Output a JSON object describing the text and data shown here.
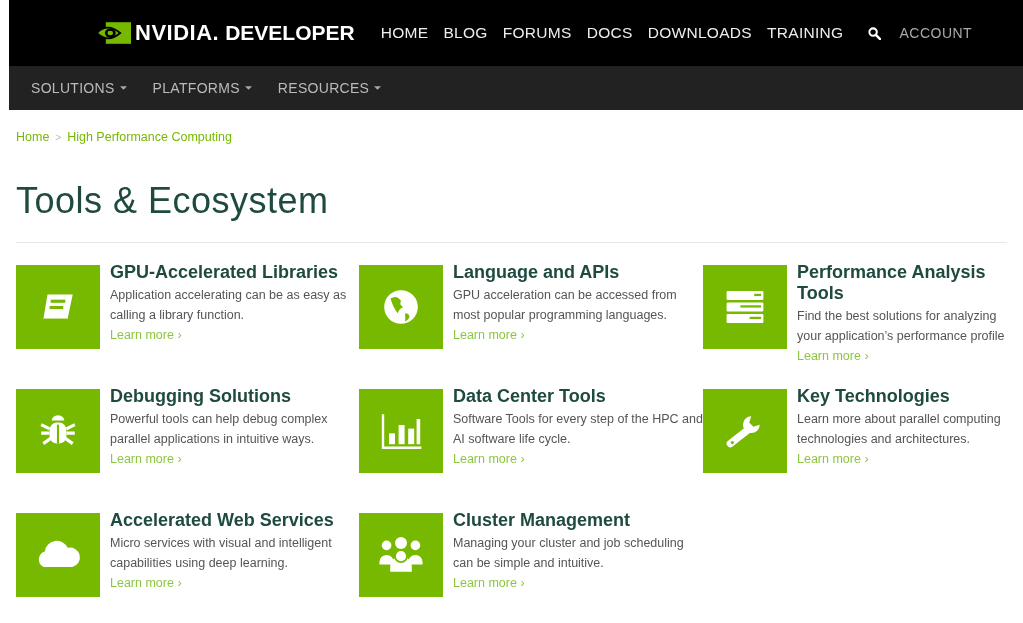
{
  "header": {
    "logo": {
      "brand": "NVIDIA.",
      "product": "DEVELOPER"
    },
    "nav": [
      "HOME",
      "BLOG",
      "FORUMS",
      "DOCS",
      "DOWNLOADS",
      "TRAINING"
    ],
    "account": "ACCOUNT"
  },
  "subnav": [
    "SOLUTIONS",
    "PLATFORMS",
    "RESOURCES"
  ],
  "breadcrumb": [
    "Home",
    "High Performance Computing"
  ],
  "breadcrumb_separator": ">",
  "title": "Tools & Ecosystem",
  "cards": [
    {
      "title": "GPU-Accelerated Libraries",
      "description": "Application accelerating can be as easy as calling a library function.",
      "link": "Learn more ›"
    },
    {
      "title": "Language and APIs",
      "description": "GPU acceleration can be accessed from most popular programming languages.",
      "link": "Learn more ›"
    },
    {
      "title": "Performance Analysis Tools",
      "description": "Find the best solutions for analyzing your application’s performance profile",
      "link": "Learn more ›"
    },
    {
      "title": "Debugging Solutions",
      "description": "Powerful tools can help debug complex parallel applications in intuitive ways.",
      "link": "Learn more ›"
    },
    {
      "title": "Data Center Tools",
      "description": "Software Tools for every step of the HPC and AI software life cycle.",
      "link": "Learn more ›"
    },
    {
      "title": "Key Technologies",
      "description": "Learn more about parallel computing technologies and architectures.",
      "link": "Learn more ›"
    },
    {
      "title": "Accelerated Web Services",
      "description": "Micro services with visual and intelligent capabilities using deep learning.",
      "link": "Learn more ›"
    },
    {
      "title": "Cluster Management",
      "description": "Managing your cluster and job scheduling can be simple and intuitive.",
      "link": "Learn more ›"
    }
  ]
}
